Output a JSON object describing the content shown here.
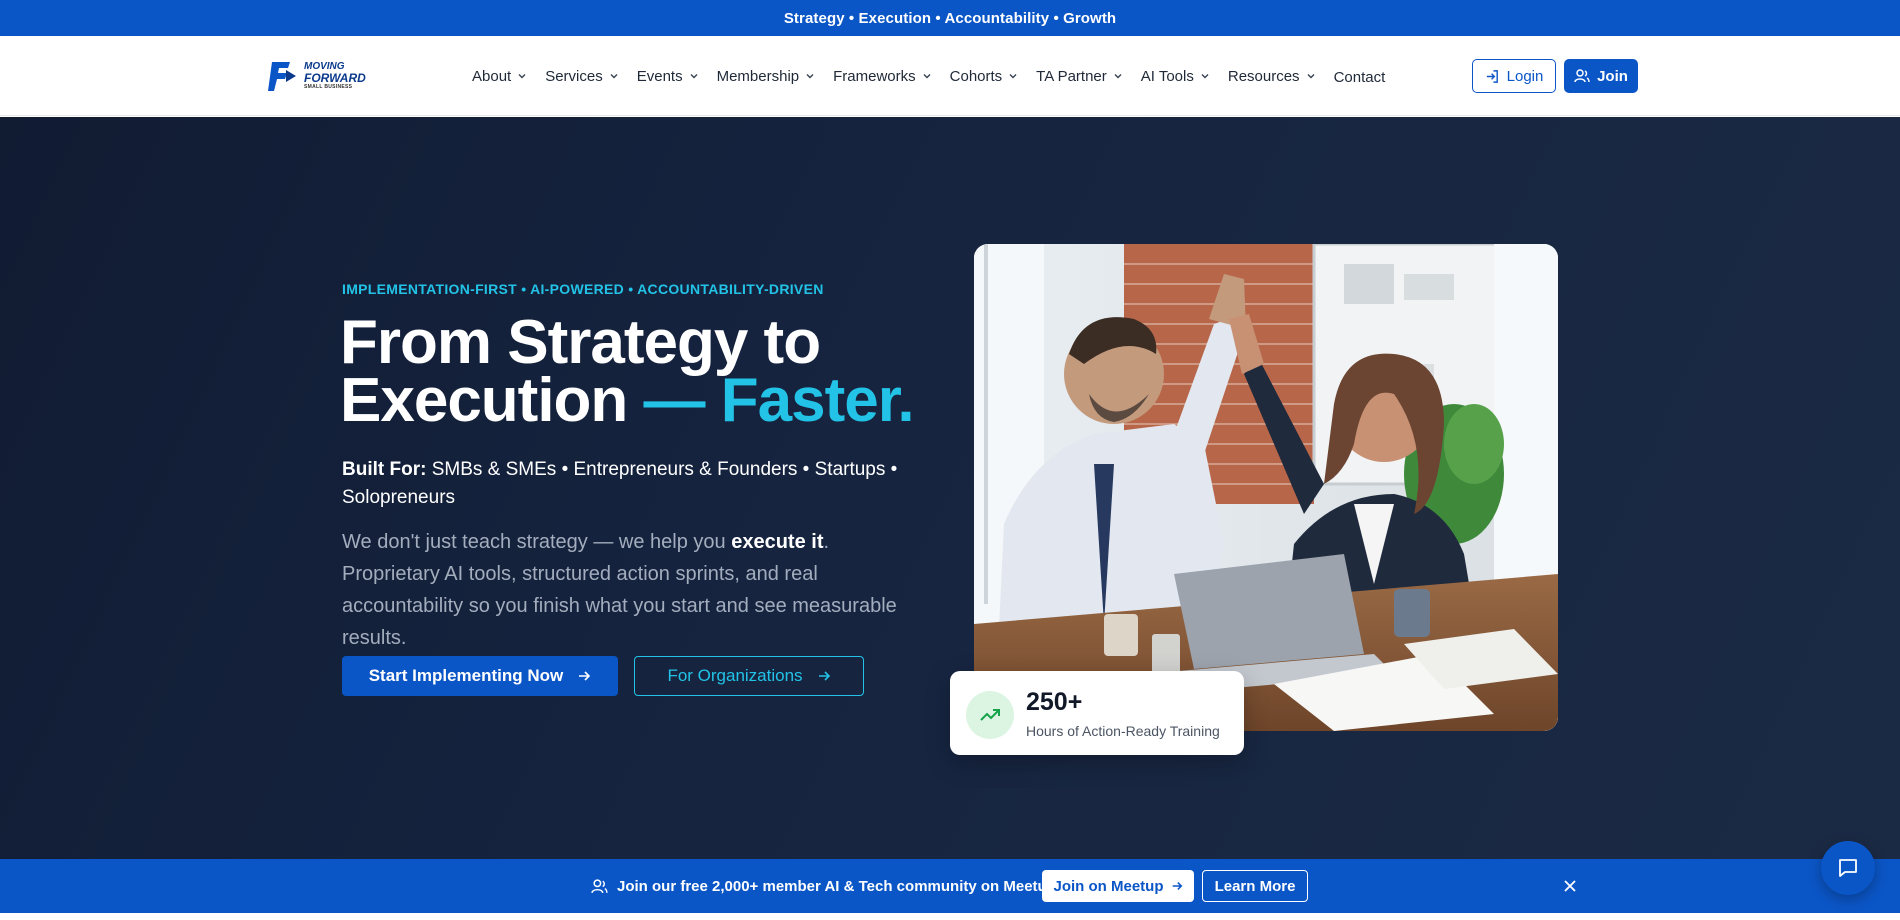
{
  "announcement": {
    "text": "Strategy • Execution • Accountability • Growth"
  },
  "logo": {
    "line1": "MOVING",
    "line2": "FORWARD",
    "line3": "SMALL BUSINESS"
  },
  "nav": {
    "items": [
      {
        "label": "About",
        "dropdown": true
      },
      {
        "label": "Services",
        "dropdown": true
      },
      {
        "label": "Events",
        "dropdown": true
      },
      {
        "label": "Membership",
        "dropdown": true
      },
      {
        "label": "Frameworks",
        "dropdown": true
      },
      {
        "label": "Cohorts",
        "dropdown": true
      },
      {
        "label": "TA Partner",
        "dropdown": true
      },
      {
        "label": "AI Tools",
        "dropdown": true
      },
      {
        "label": "Resources",
        "dropdown": true
      },
      {
        "label": "Contact",
        "dropdown": false
      }
    ],
    "login_label": "Login",
    "join_label": "Join"
  },
  "hero": {
    "eyebrow": "IMPLEMENTATION-FIRST • AI-POWERED • ACCOUNTABILITY-DRIVEN",
    "title_line1": "From Strategy to",
    "title_line2": "Execution ",
    "title_accent": "— Faster.",
    "built_for_label": "Built For:",
    "built_for_text": " SMBs & SMEs • Entrepreneurs & Founders • Startups • Solopreneurs",
    "lead_part1": "We don't just teach strategy — we help you ",
    "lead_bold": "execute it",
    "lead_part2": ". Proprietary AI tools, structured action sprints, and real accountability so you finish what you start and see measurable results.",
    "cta_primary": "Start Implementing Now",
    "cta_secondary": "For Organizations"
  },
  "stat": {
    "value": "250+",
    "label": "Hours of Action-Ready Training"
  },
  "community_bar": {
    "text": "Join our free 2,000+ member AI & Tech community on Meetup",
    "meetup_label": "Join on Meetup",
    "learn_label": "Learn More"
  },
  "colors": {
    "brand_blue": "#0b56c7",
    "accent_cyan": "#22c3e6",
    "hero_bg": "#162440",
    "stat_green": "#16a34a"
  },
  "icons": {
    "login": "login-icon",
    "join": "user-plus-icon",
    "arrow": "arrow-right-icon",
    "trend": "trending-up-icon",
    "users": "users-icon",
    "close": "close-icon",
    "chat": "chat-icon"
  }
}
